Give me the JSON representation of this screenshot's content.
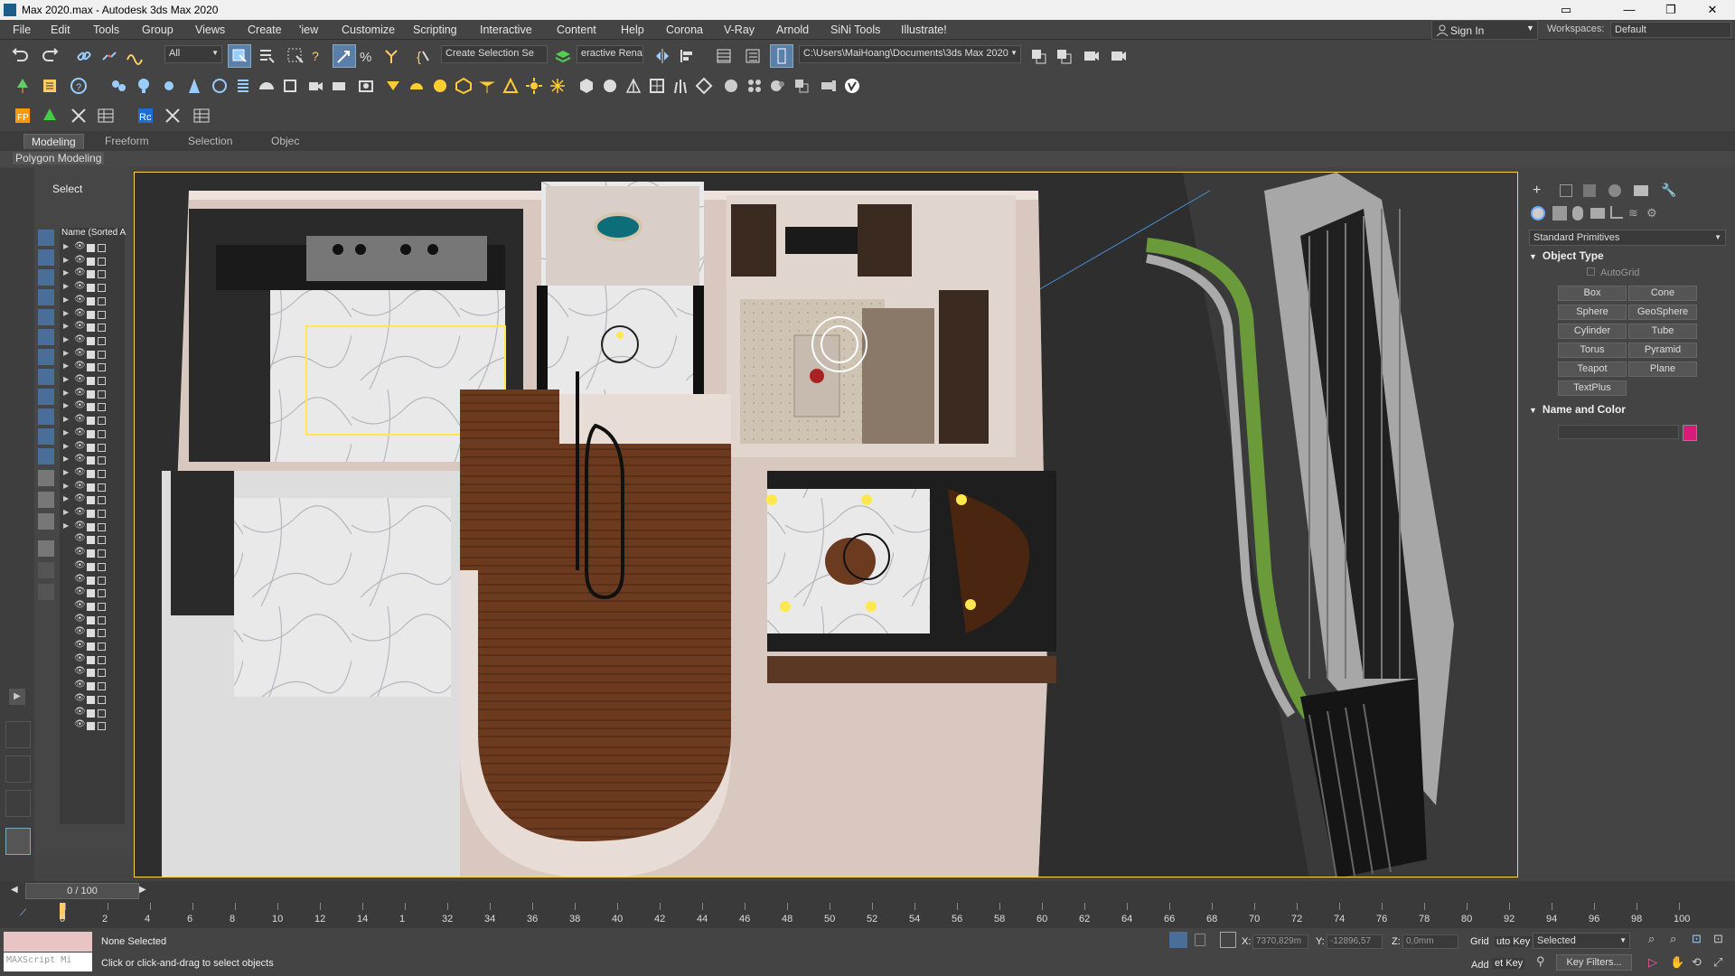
{
  "window": {
    "title": "Max 2020.max - Autodesk 3ds Max 2020",
    "minimize": "—",
    "maximize": "❐",
    "close": "✕"
  },
  "menu": [
    "File",
    "Edit",
    "Tools",
    "Group",
    "Views",
    "Create",
    "'iew",
    "Customize",
    "Scripting",
    "Interactive",
    "Content",
    "Help",
    "Corona",
    "V-Ray",
    "Arnold",
    "SiNi Tools",
    "Illustrate!"
  ],
  "signin": {
    "label": "Sign In"
  },
  "workspace": {
    "label": "Workspaces:",
    "value": "Default"
  },
  "toolbar1": {
    "filter_value": "All",
    "selection_set": "Create Selection Se",
    "interactive_rename": "eractive Renar",
    "project_path": "C:\\Users\\MaiHoang\\Documents\\3ds Max 2020"
  },
  "ribbon": {
    "tabs": [
      "Modeling",
      "Freeform",
      "Selection",
      "Objec"
    ],
    "panel": "Polygon Modeling"
  },
  "scene_explorer": {
    "title": "Select",
    "column_header": "Name (Sorted A"
  },
  "command_panel": {
    "category": "Standard Primitives",
    "object_type_title": "Object Type",
    "autogrid": "AutoGrid",
    "buttons": [
      "Box",
      "Cone",
      "Sphere",
      "GeoSphere",
      "Cylinder",
      "Tube",
      "Torus",
      "Pyramid",
      "Teapot",
      "Plane",
      "TextPlus"
    ],
    "name_color_title": "Name and Color",
    "color": "#d81b7a"
  },
  "timeline": {
    "frame": "0 / 100",
    "ticks": [
      "0",
      "2",
      "4",
      "6",
      "8",
      "10",
      "12",
      "14",
      "1",
      "32",
      "34",
      "36",
      "38",
      "40",
      "42",
      "44",
      "46",
      "48",
      "50",
      "52",
      "54",
      "56",
      "58",
      "60",
      "62",
      "64",
      "66",
      "68",
      "70",
      "72",
      "74",
      "76",
      "78",
      "80",
      "92",
      "94",
      "96",
      "98",
      "100"
    ]
  },
  "status": {
    "maxscript": "MAXScript Mi",
    "selected": "None Selected",
    "prompt": "Click or click-and-drag to select objects",
    "x_label": "X:",
    "x_value": "7370,829m",
    "y_label": "Y:",
    "y_value": "-12896,57",
    "z_label": "Z:",
    "z_value": "0,0mm",
    "grid": "Grid",
    "auto_key": "uto Key",
    "selected_dd": "Selected",
    "set_key": "et Key",
    "key_filters": "Key Filters...",
    "add": "Add"
  }
}
